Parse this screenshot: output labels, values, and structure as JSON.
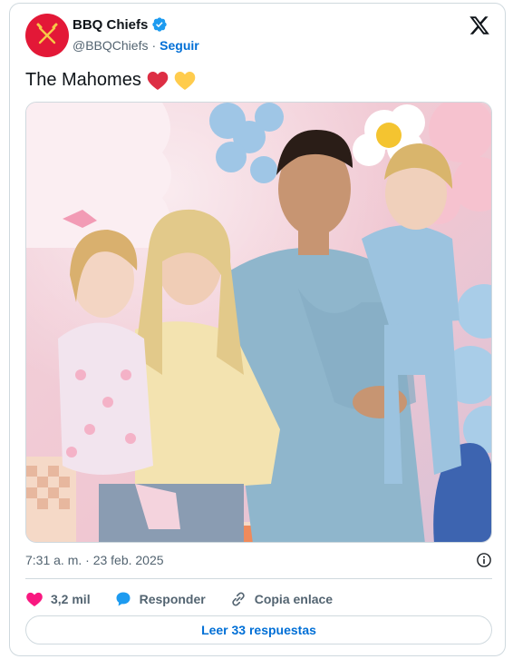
{
  "account": {
    "name": "BBQ Chiefs",
    "handle": "@BBQChiefs",
    "separator": "·",
    "follow_label": "Seguir",
    "avatar_color": "#e31837"
  },
  "tweet": {
    "text": "The Mahomes",
    "emojis": [
      "red-heart",
      "yellow-heart"
    ]
  },
  "meta": {
    "timestamp": "7:31 a. m. · 23 feb. 2025"
  },
  "actions": {
    "likes_count": "3,2 mil",
    "reply_label": "Responder",
    "copy_label": "Copia enlace"
  },
  "replies_button": {
    "label": "Leer 33 respuestas"
  },
  "colors": {
    "link": "#006fd6",
    "verified": "#1d9bf0",
    "like": "#f91880",
    "muted": "#536471",
    "border": "#cfd9de"
  }
}
